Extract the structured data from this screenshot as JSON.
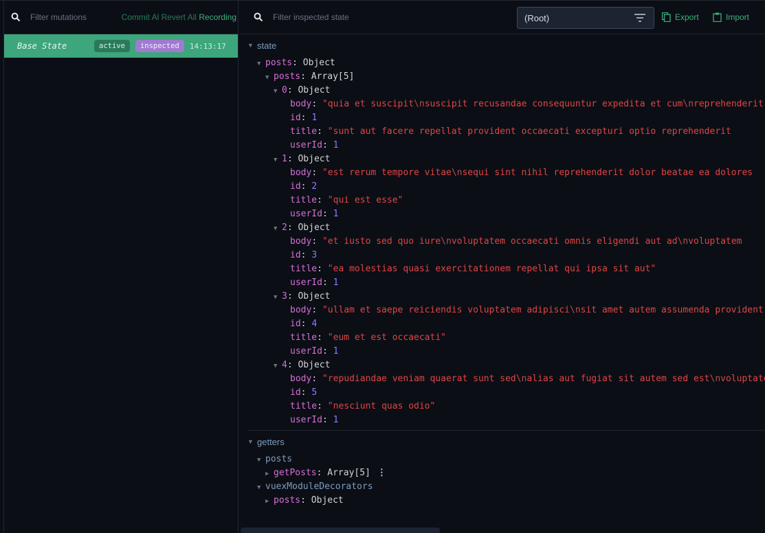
{
  "mutations_panel": {
    "filter_placeholder": "Filter mutations",
    "commit_all": "Commit Al",
    "revert_all": "Revert All",
    "recording": "Recording",
    "items": [
      {
        "name": "Base State",
        "badges": [
          "active",
          "inspected"
        ],
        "time": "14:13:17"
      }
    ]
  },
  "inspector": {
    "filter_placeholder": "Filter inspected state",
    "module_select": "(Root)",
    "export_label": "Export",
    "import_label": "Import",
    "state": {
      "label": "state",
      "root_key": "posts",
      "root_type": "Object",
      "array_key": "posts",
      "array_type": "Array[5]",
      "posts": [
        {
          "index": "0",
          "type": "Object",
          "body": "\"quia et suscipit\\nsuscipit recusandae consequuntur expedita et cum\\nreprehenderit",
          "id": "1",
          "title": "\"sunt aut facere repellat provident occaecati excepturi optio reprehenderit",
          "userId": "1"
        },
        {
          "index": "1",
          "type": "Object",
          "body": "\"est rerum tempore vitae\\nsequi sint nihil reprehenderit dolor beatae ea dolores",
          "id": "2",
          "title": "\"qui est esse\"",
          "userId": "1"
        },
        {
          "index": "2",
          "type": "Object",
          "body": "\"et iusto sed quo iure\\nvoluptatem occaecati omnis eligendi aut ad\\nvoluptatem",
          "id": "3",
          "title": "\"ea molestias quasi exercitationem repellat qui ipsa sit aut\"",
          "userId": "1"
        },
        {
          "index": "3",
          "type": "Object",
          "body": "\"ullam et saepe reiciendis voluptatem adipisci\\nsit amet autem assumenda provident",
          "id": "4",
          "title": "\"eum et est occaecati\"",
          "userId": "1"
        },
        {
          "index": "4",
          "type": "Object",
          "body": "\"repudiandae veniam quaerat sunt sed\\nalias aut fugiat sit autem sed est\\nvoluptatem",
          "id": "5",
          "title": "\"nesciunt quas odio\"",
          "userId": "1"
        }
      ]
    },
    "getters": {
      "label": "getters",
      "modules": [
        {
          "name": "posts",
          "entries": [
            {
              "key": "getPosts",
              "value": "Array[5]"
            }
          ]
        },
        {
          "name": "vuexModuleDecorators",
          "entries": [
            {
              "key": "posts",
              "value": "Object"
            }
          ]
        }
      ]
    }
  },
  "colors": {
    "accent": "#3da67c",
    "inspected_badge": "#a07ad0",
    "string": "#e04545",
    "number": "#8a7dff",
    "key": "#d66fd6"
  }
}
